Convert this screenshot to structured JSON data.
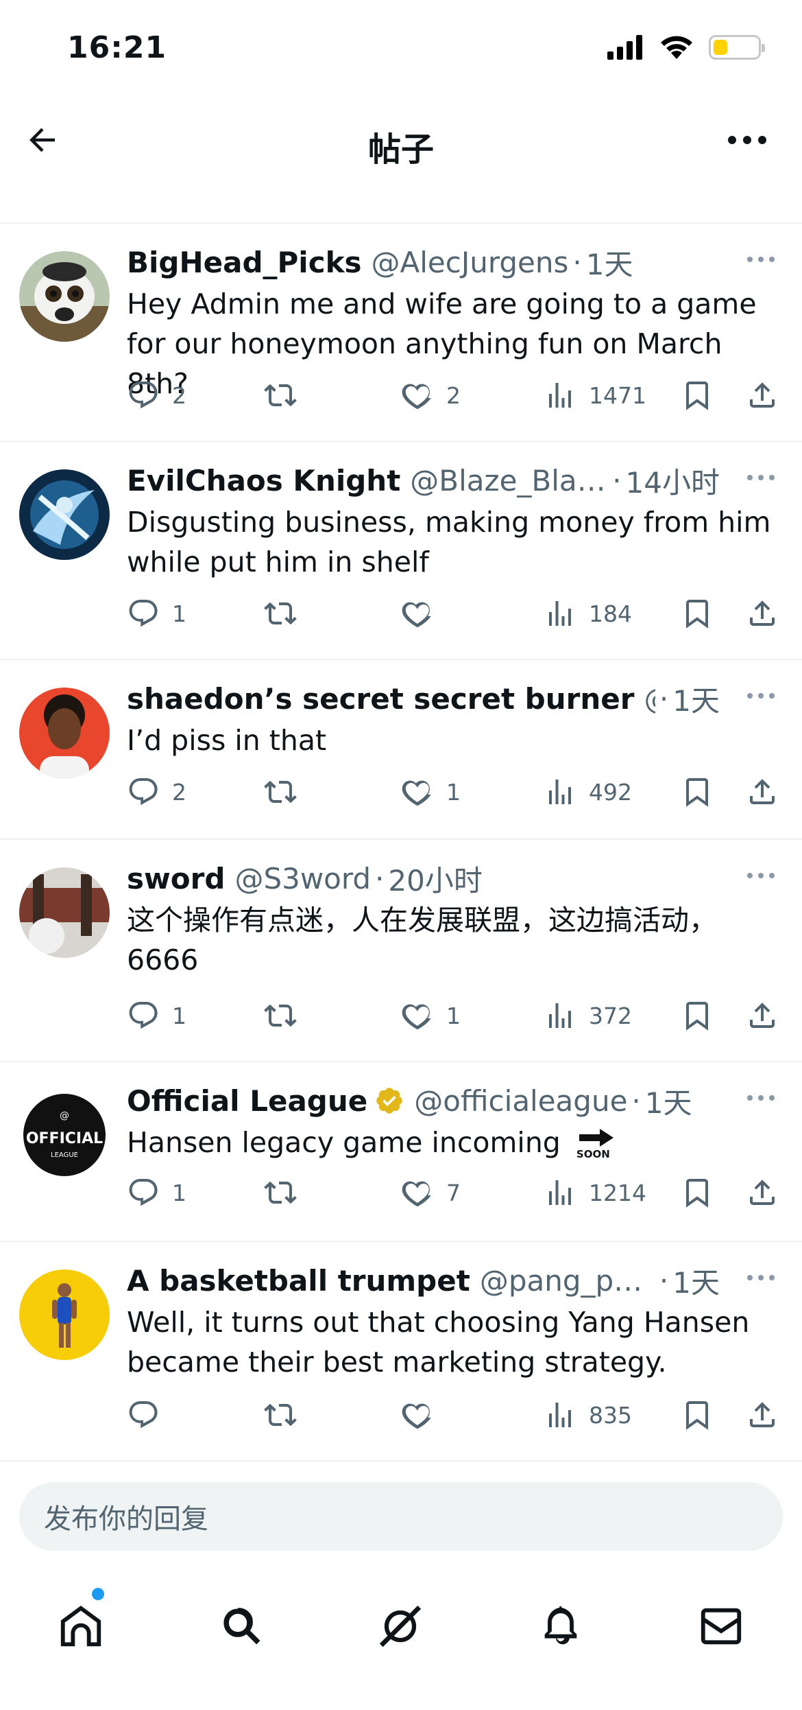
{
  "status_bar": {
    "time": "16:21",
    "battery_level": 0.33,
    "battery_color": "#ffd200"
  },
  "nav": {
    "title": "帖子",
    "back_icon": "arrow-left-icon",
    "more_icon": "more-horizontal-icon"
  },
  "replies": [
    {
      "name": "BigHead_Picks",
      "handle": "@AlecJurgens",
      "dot": "·",
      "time": "1天",
      "verified": false,
      "text": "Hey Admin me and wife are going to a game for our honeymoon anything fun on March 8th?",
      "replies": "2",
      "retweets": "",
      "likes": "2",
      "views": "1471"
    },
    {
      "name": "EvilChaos Knight",
      "handle": "@Blaze_Blade_...",
      "dot": "·",
      "time": "14小时",
      "verified": false,
      "text": "Disgusting business, making money from him while put him in shelf",
      "replies": "1",
      "retweets": "",
      "likes": "",
      "views": "184"
    },
    {
      "name": "shaedon’s secret secret burner",
      "handle": "@sh...",
      "dot": "·",
      "time": "1天",
      "verified": false,
      "text": "I’d piss in that",
      "replies": "2",
      "retweets": "",
      "likes": "1",
      "views": "492"
    },
    {
      "name": "sword",
      "handle": "@S3word",
      "dot": "·",
      "time": "20小时",
      "verified": false,
      "text": "这个操作有点迷，人在发展联盟，这边搞活动，6666",
      "replies": "1",
      "retweets": "",
      "likes": "1",
      "views": "372"
    },
    {
      "name": "Official League",
      "handle": "@officialeague",
      "dot": "·",
      "time": "1天",
      "verified": true,
      "text": "Hansen legacy game incoming",
      "emoji": "SOON",
      "replies": "1",
      "retweets": "",
      "likes": "7",
      "views": "1214"
    },
    {
      "name": "A basketball trumpet",
      "handle": "@pang_pangwe",
      "dot": "·",
      "time": "1天",
      "verified": false,
      "text": "Well, it turns out that choosing Yang Hansen became their best marketing strategy.",
      "replies": "",
      "retweets": "",
      "likes": "",
      "views": "835"
    }
  ],
  "avatar_logo_text": {
    "top": "@",
    "main": "OFFICIAL",
    "sub": "LEAGUE"
  },
  "composer": {
    "placeholder": "发布你的回复"
  },
  "tabs": [
    "home-icon",
    "search-icon",
    "grok-icon",
    "bell-icon",
    "mail-icon"
  ],
  "colors": {
    "accent": "#1d9bf0",
    "secondary_text": "#536471",
    "verified_gold": "#e2b719"
  }
}
